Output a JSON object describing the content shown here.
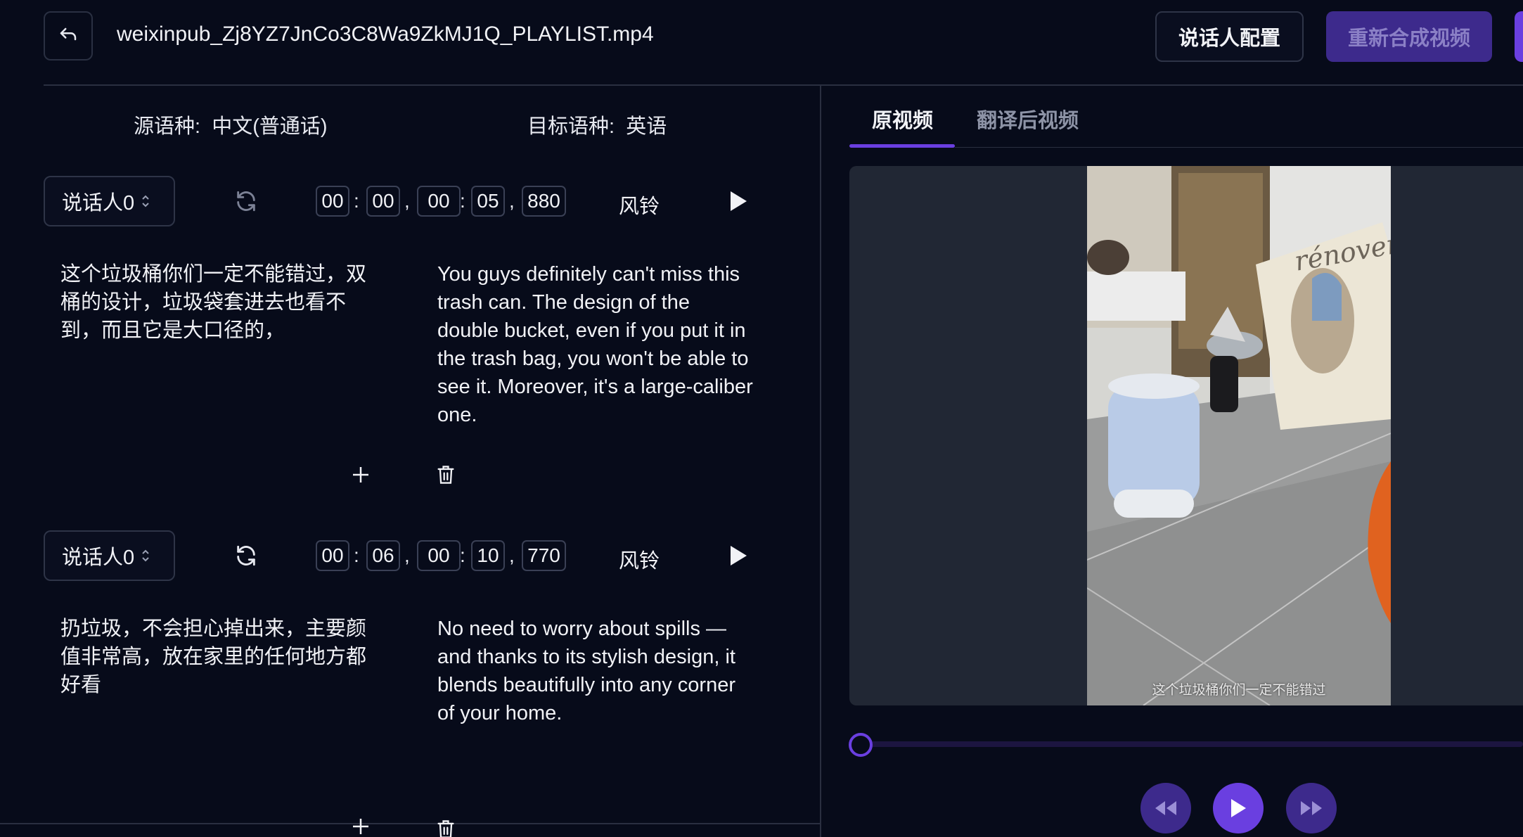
{
  "header": {
    "filename": "weixinpub_Zj8YZ7JnCo3C8Wa9ZkMJ1Q_PLAYLIST.mp4",
    "speaker_config_label": "说话人配置",
    "resynthesize_label": "重新合成视频"
  },
  "languages": {
    "source_label": "源语种:",
    "source_value": "中文(普通话)",
    "target_label": "目标语种:",
    "target_value": "英语"
  },
  "segments": [
    {
      "speaker": "说话人0",
      "start": [
        "00",
        "00",
        "00"
      ],
      "end": [
        "05",
        "880"
      ],
      "voice": "风铃",
      "source_text": "这个垃圾桶你们一定不能错过，双桶的设计，垃圾袋套进去也看不到，而且它是大口径的，",
      "target_text": "You guys definitely can't miss this trash can. The design of the double bucket, even if you put it in the trash bag, you won't be able to see it. Moreover, it's a large-caliber one."
    },
    {
      "speaker": "说话人0",
      "start": [
        "00",
        "06",
        "00"
      ],
      "end": [
        "10",
        "770"
      ],
      "voice": "风铃",
      "source_text": "扔垃圾，不会担心掉出来，主要颜值非常高，放在家里的任何地方都好看",
      "target_text": "No need to worry about spills — and thanks to its stylish design, it blends beautifully into any corner of your home."
    }
  ],
  "video": {
    "tabs": [
      "原视频",
      "翻译后视频"
    ],
    "active_tab": 0,
    "subtitle": "这个垃圾桶你们一定不能错过",
    "poster_text": "rénover",
    "progress": 0
  },
  "colors": {
    "background": "#070b1a",
    "accent": "#6a3fe0",
    "primary_button": "#3d2a8c",
    "video_panel": "#212734"
  },
  "icons": {
    "back": "return-arrow-icon",
    "regenerate": "refresh-icon",
    "play": "play-icon",
    "add": "plus-icon",
    "delete": "trash-icon",
    "rewind": "rewind-icon",
    "forward": "fast-forward-icon"
  }
}
